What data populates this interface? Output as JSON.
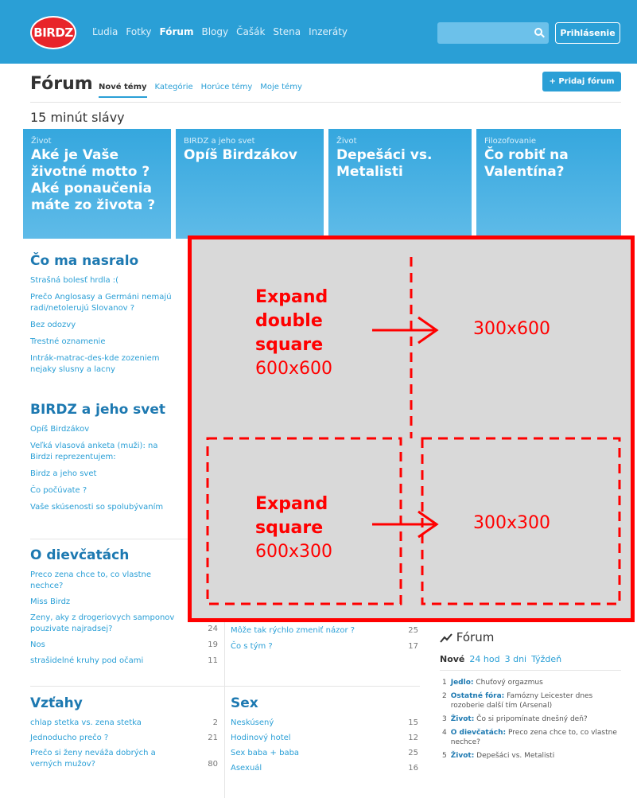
{
  "header": {
    "logo": "BIRDZ",
    "nav": [
      "Ľudia",
      "Fotky",
      "Fórum",
      "Blogy",
      "Čašák",
      "Stena",
      "Inzeráty"
    ],
    "login": "Prihlásenie"
  },
  "forum": {
    "title": "Fórum",
    "tabs": [
      "Nové témy",
      "Kategórie",
      "Horúce témy",
      "Moje témy"
    ],
    "add_button": "+ Pridaj fórum",
    "fifteen": "15 minút slávy"
  },
  "tiles": [
    {
      "cat": "Život",
      "title": "Aké je Vaše životné motto ? Aké ponaučenia máte zo života ?"
    },
    {
      "cat": "BIRDZ a jeho svet",
      "title": "Opíš Birdzákov"
    },
    {
      "cat": "Život",
      "title": "Depešáci vs. Metalisti"
    },
    {
      "cat": "Filozofovanie",
      "title": "Čo robiť na Valentína?"
    }
  ],
  "sections": {
    "co_ma_nasralo": {
      "title": "Čo ma nasralo",
      "items": [
        "Strašná bolesť hrdla :(",
        "Prečo Anglosasy a Germáni nemajú radi/netolerujú Slovanov ?",
        "Bez odozvy",
        "Trestné oznamenie",
        "Intrák-matrac-des-kde zozeniem nejaky slusny a lacny"
      ]
    },
    "birdz": {
      "title": "BIRDZ a jeho svet",
      "items": [
        "Opíš Birdzákov",
        "Veľká vlasová anketa (muži): na Birdzi reprezentujem:",
        "Birdz a jeho svet",
        "Čo počúvate ?",
        "Vaše skúsenosti so spolubývaním"
      ]
    },
    "dievcatach": {
      "title": "O dievčatách",
      "items": [
        {
          "t": "Preco zena chce to, co vlastne nechce?",
          "n": ""
        },
        {
          "t": "Miss Birdz",
          "n": ""
        },
        {
          "t": "Zeny, aky z drogeriovych samponov pouzivate najradsej?",
          "n": "24"
        },
        {
          "t": "Nos",
          "n": "19"
        },
        {
          "t": "strašidelné kruhy pod očami",
          "n": "11"
        }
      ],
      "mid": [
        {
          "t": "Môže tak rýchlo zmeniť názor ?",
          "n": "25"
        },
        {
          "t": "Čo s tým ?",
          "n": "17"
        }
      ]
    },
    "vztahy": {
      "title": "Vzťahy",
      "items": [
        {
          "t": "chlap stetka vs. zena stetka",
          "n": "2"
        },
        {
          "t": "Jednoducho prečo ?",
          "n": "21"
        },
        {
          "t": "Prečo si ženy neváža dobrých a verných mužov?",
          "n": "80"
        }
      ]
    },
    "sex": {
      "title": "Sex",
      "items": [
        {
          "t": "Neskúsený",
          "n": "15"
        },
        {
          "t": "Hodinový hotel",
          "n": "12"
        },
        {
          "t": "Sex baba + baba",
          "n": "25"
        },
        {
          "t": "Asexuál",
          "n": "16"
        }
      ]
    }
  },
  "widget": {
    "title": "Fórum",
    "tabs": [
      "Nové",
      "24 hod",
      "3 dni",
      "Týždeň"
    ],
    "items": [
      {
        "cat": "Jedlo:",
        "t": "Chuťový orgazmus"
      },
      {
        "cat": "Ostatné fóra:",
        "t": "Famózny Leicester dnes rozoberie další tím (Arsenal)"
      },
      {
        "cat": "Život:",
        "t": "Čo si pripomínate dnešný deň?"
      },
      {
        "cat": "O dievčatách:",
        "t": "Preco zena chce to, co vlastne nechce?"
      },
      {
        "cat": "Život:",
        "t": "Depešáci vs. Metalisti"
      }
    ]
  },
  "annotation": {
    "big_label": [
      "Expand",
      "double",
      "square"
    ],
    "big_size": "600x600",
    "big_target": "300x600",
    "small_label": [
      "Expand",
      "square"
    ],
    "small_size": "600x300",
    "small_target": "300x300"
  }
}
